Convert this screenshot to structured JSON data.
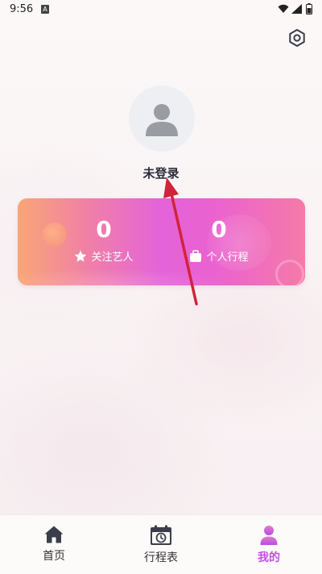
{
  "status_bar": {
    "time": "9:56",
    "notification": "A"
  },
  "profile": {
    "username": "未登录"
  },
  "stats": [
    {
      "value": "0",
      "label": "关注艺人",
      "icon": "star-icon"
    },
    {
      "value": "0",
      "label": "个人行程",
      "icon": "briefcase-icon"
    }
  ],
  "tabs": [
    {
      "label": "首页",
      "icon": "home-icon"
    },
    {
      "label": "行程表",
      "icon": "calendar-clock-icon"
    },
    {
      "label": "我的",
      "icon": "person-icon",
      "active": true
    }
  ],
  "colors": {
    "accent": "#c24fe0",
    "card_gradient_start": "#f9a676",
    "card_gradient_mid": "#e463d9",
    "card_gradient_end": "#f67aa8",
    "annotation_arrow": "#d0243a"
  }
}
